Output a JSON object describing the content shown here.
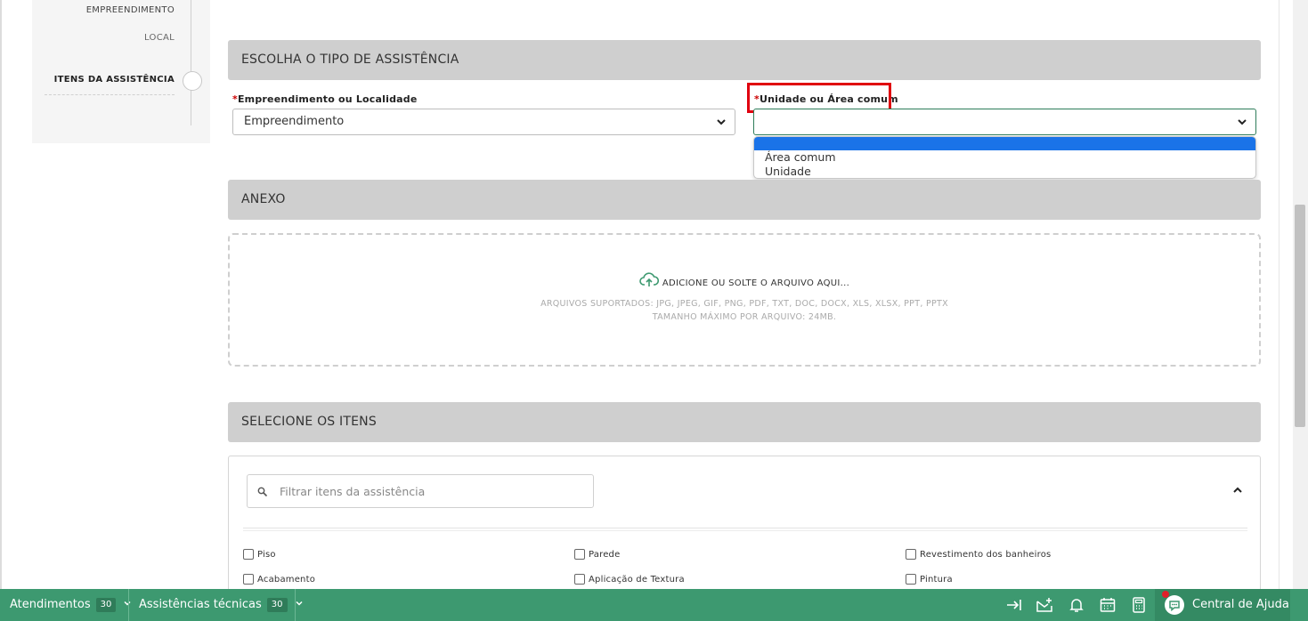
{
  "steps": {
    "items": [
      {
        "label": "EMPREENDIMENTO"
      },
      {
        "label": "LOCAL"
      },
      {
        "label": "ITENS DA ASSISTÊNCIA"
      }
    ]
  },
  "sections": {
    "assistance_type": "ESCOLHA O TIPO DE ASSISTÊNCIA",
    "attachment": "ANEXO",
    "items": "SELECIONE OS ITENS"
  },
  "form": {
    "required_mark": "*",
    "empreendimento_label": "Empreendimento ou Localidade",
    "empreendimento_value": "Empreendimento",
    "unidade_label": "Unidade ou Área comum",
    "unidade_value": "",
    "unidade_options": [
      "",
      "Área comum",
      "Unidade"
    ]
  },
  "dropzone": {
    "main": "ADICIONE OU SOLTE O ARQUIVO AQUI...",
    "supported": "ARQUIVOS SUPORTADOS: JPG, JPEG, GIF, PNG, PDF, TXT, DOC, DOCX, XLS, XLSX, PPT, PPTX",
    "max_size": "TAMANHO MÁXIMO POR ARQUIVO: 24MB."
  },
  "items_panel": {
    "filter_placeholder": "Filtrar itens da assistência",
    "checkboxes": [
      "Piso",
      "Parede",
      "Revestimento dos banheiros",
      "Acabamento",
      "Aplicação de Textura",
      "Pintura"
    ]
  },
  "bottombar": {
    "atendimentos_label": "Atendimentos",
    "atendimentos_count": "30",
    "assistencias_label": "Assistências técnicas",
    "assistencias_count": "30",
    "help_label": "Central de Ajuda"
  },
  "colors": {
    "accent_green": "#3d9970",
    "highlight_red": "#e0000f",
    "dropdown_selected": "#1a73e8"
  }
}
